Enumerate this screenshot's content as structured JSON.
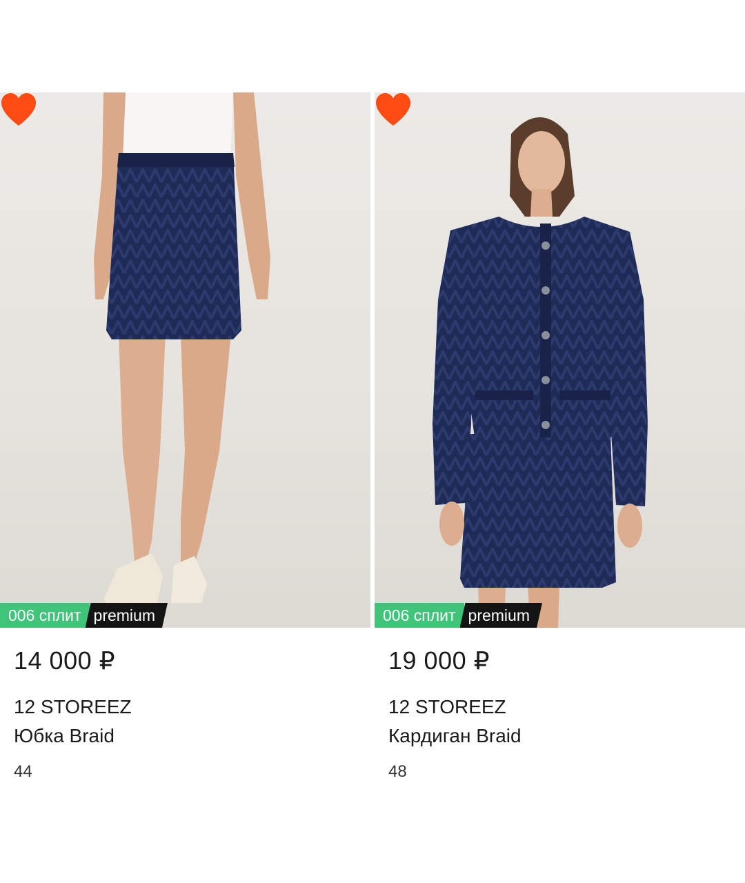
{
  "products": [
    {
      "price": "14 000 ₽",
      "brand": "12 STOREEZ",
      "title": "Юбка Braid",
      "size": "44",
      "badge_split": "006 сплит",
      "badge_premium": "premium",
      "favorite": true,
      "image_icon": "knit-skirt-photo"
    },
    {
      "price": "19 000 ₽",
      "brand": "12 STOREEZ",
      "title": "Кардиган Braid",
      "size": "48",
      "badge_split": "006 сплит",
      "badge_premium": "premium",
      "favorite": true,
      "image_icon": "knit-cardigan-photo"
    }
  ],
  "colors": {
    "heart": "#ff4a12",
    "split_badge": "#3fc47a",
    "premium_badge": "#141414",
    "garment_navy": "#1e2a55"
  }
}
